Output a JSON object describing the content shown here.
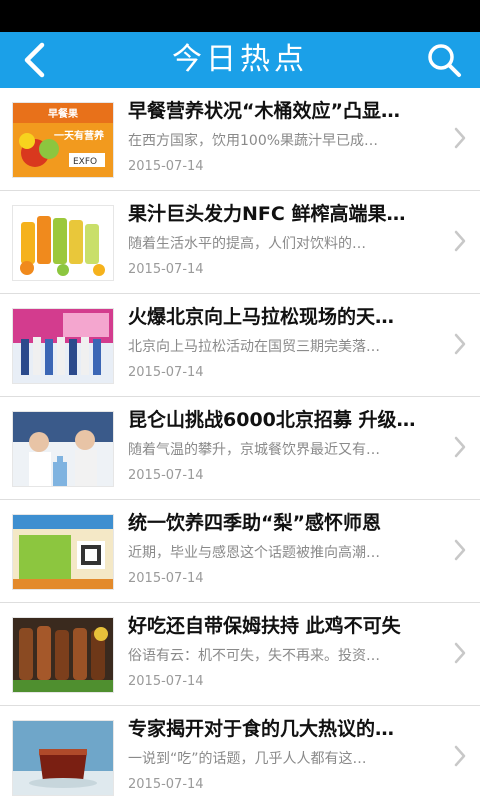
{
  "header": {
    "title": "今日热点",
    "back_icon": "chevron-left-icon",
    "search_icon": "search-icon",
    "accent_color": "#1ba0e8"
  },
  "articles": [
    {
      "title": "早餐营养状况“木桶效应”凸显…",
      "summary": "在西方国家，饮用100%果蔬汁早已成…",
      "date": "2015-07-14",
      "thumb_text": "早餐果一天有营养"
    },
    {
      "title": "果汁巨头发力NFC 鲜榨高端果…",
      "summary": "随着生活水平的提高，人们对饮料的…",
      "date": "2015-07-14"
    },
    {
      "title": "火爆北京向上马拉松现场的天…",
      "summary": "北京向上马拉松活动在国贸三期完美落…",
      "date": "2015-07-14"
    },
    {
      "title": "昆仑山挑战6000北京招募 升级…",
      "summary": "随着气温的攀升，京城餐饮界最近又有…",
      "date": "2015-07-14"
    },
    {
      "title": "统一饮养四季助“梨”感怀师恩",
      "summary": "近期，毕业与感恩这个话题被推向高潮…",
      "date": "2015-07-14"
    },
    {
      "title": "好吃还自带保姆扶持 此鸡不可失",
      "summary": "俗语有云：机不可失，失不再来。投资…",
      "date": "2015-07-14"
    },
    {
      "title": "专家揭开对于食的几大热议的…",
      "summary": "一说到“吃”的话题，几乎人人都有这…",
      "date": "2015-07-14"
    }
  ]
}
